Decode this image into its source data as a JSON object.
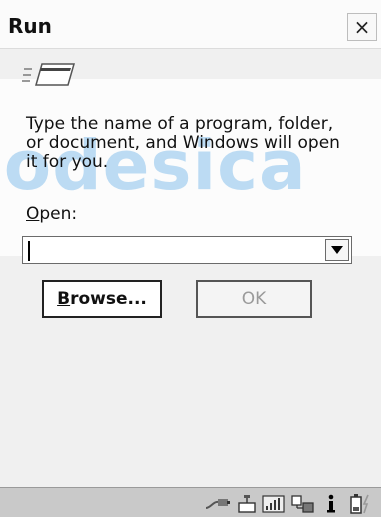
{
  "window": {
    "title": "Run",
    "close_glyph": "×"
  },
  "dialog": {
    "description": "Type the name of a program, folder,\nor document, and Windows will open\nit for you.",
    "open_label_accel": "O",
    "open_label_rest": "pen:",
    "combo": {
      "value": "",
      "dropdown_icon": "triangle-down"
    }
  },
  "buttons": {
    "browse_accel": "B",
    "browse_rest": "rowse...",
    "ok": "OK"
  },
  "watermark": {
    "text": "eodesica"
  },
  "taskbar": {
    "icons": [
      "network-cable-icon",
      "keyboard-icon",
      "signal-icon",
      "connection-icon",
      "info-icon",
      "battery-icon"
    ]
  },
  "colors": {
    "watermark": "#6eb4e8",
    "taskbar": "#c9c9c9",
    "disabled_text": "#9a9a9a"
  }
}
